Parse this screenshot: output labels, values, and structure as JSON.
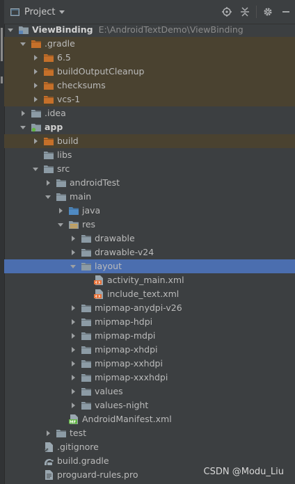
{
  "header": {
    "title": "Project"
  },
  "colors": {
    "folder": "#8c9ba5",
    "folder_orange": "#c5702a",
    "folder_blue": "#4f8ac2",
    "selection": "#4b6eaf",
    "excluded_bg": "#4a4230"
  },
  "tree": [
    {
      "label": "ViewBinding",
      "path": "E:\\AndroidTextDemo\\ViewBinding",
      "level": 0,
      "state": "open",
      "icon": "module-folder-icon",
      "bold": true
    },
    {
      "label": ".gradle",
      "level": 1,
      "state": "open",
      "icon": "folder-orange-icon",
      "hl": "brown"
    },
    {
      "label": "6.5",
      "level": 2,
      "state": "closed",
      "icon": "folder-orange-icon",
      "hl": "brown"
    },
    {
      "label": "buildOutputCleanup",
      "level": 2,
      "state": "closed",
      "icon": "folder-orange-icon",
      "hl": "brown"
    },
    {
      "label": "checksums",
      "level": 2,
      "state": "closed",
      "icon": "folder-orange-icon",
      "hl": "brown"
    },
    {
      "label": "vcs-1",
      "level": 2,
      "state": "closed",
      "icon": "folder-orange-icon",
      "hl": "brown"
    },
    {
      "label": ".idea",
      "level": 1,
      "state": "closed",
      "icon": "folder-icon"
    },
    {
      "label": "app",
      "level": 1,
      "state": "open",
      "icon": "app-module-icon",
      "bold": true
    },
    {
      "label": "build",
      "level": 2,
      "state": "closed",
      "icon": "folder-orange-icon",
      "hl": "brown"
    },
    {
      "label": "libs",
      "level": 2,
      "state": "none",
      "icon": "folder-icon"
    },
    {
      "label": "src",
      "level": 2,
      "state": "open",
      "icon": "folder-icon"
    },
    {
      "label": "androidTest",
      "level": 3,
      "state": "closed",
      "icon": "folder-icon"
    },
    {
      "label": "main",
      "level": 3,
      "state": "open",
      "icon": "folder-icon"
    },
    {
      "label": "java",
      "level": 4,
      "state": "closed",
      "icon": "folder-blue-icon"
    },
    {
      "label": "res",
      "level": 4,
      "state": "open",
      "icon": "resource-folder-icon"
    },
    {
      "label": "drawable",
      "level": 5,
      "state": "closed",
      "icon": "folder-icon"
    },
    {
      "label": "drawable-v24",
      "level": 5,
      "state": "closed",
      "icon": "folder-icon"
    },
    {
      "label": "layout",
      "level": 5,
      "state": "open",
      "icon": "folder-icon",
      "selected": true
    },
    {
      "label": "activity_main.xml",
      "level": 6,
      "state": "none",
      "icon": "xml-file-icon"
    },
    {
      "label": "include_text.xml",
      "level": 6,
      "state": "none",
      "icon": "xml-file-icon"
    },
    {
      "label": "mipmap-anydpi-v26",
      "level": 5,
      "state": "closed",
      "icon": "folder-icon"
    },
    {
      "label": "mipmap-hdpi",
      "level": 5,
      "state": "closed",
      "icon": "folder-icon"
    },
    {
      "label": "mipmap-mdpi",
      "level": 5,
      "state": "closed",
      "icon": "folder-icon"
    },
    {
      "label": "mipmap-xhdpi",
      "level": 5,
      "state": "closed",
      "icon": "folder-icon"
    },
    {
      "label": "mipmap-xxhdpi",
      "level": 5,
      "state": "closed",
      "icon": "folder-icon"
    },
    {
      "label": "mipmap-xxxhdpi",
      "level": 5,
      "state": "closed",
      "icon": "folder-icon"
    },
    {
      "label": "values",
      "level": 5,
      "state": "closed",
      "icon": "folder-icon"
    },
    {
      "label": "values-night",
      "level": 5,
      "state": "closed",
      "icon": "folder-icon"
    },
    {
      "label": "AndroidManifest.xml",
      "level": 4,
      "state": "none",
      "icon": "manifest-file-icon"
    },
    {
      "label": "test",
      "level": 3,
      "state": "closed",
      "icon": "folder-icon"
    },
    {
      "label": ".gitignore",
      "level": 2,
      "state": "none",
      "icon": "gitignore-file-icon"
    },
    {
      "label": "build.gradle",
      "level": 2,
      "state": "none",
      "icon": "gradle-file-icon"
    },
    {
      "label": "proguard-rules.pro",
      "level": 2,
      "state": "none",
      "icon": "text-file-icon"
    }
  ],
  "watermark": "CSDN @Modu_Liu"
}
